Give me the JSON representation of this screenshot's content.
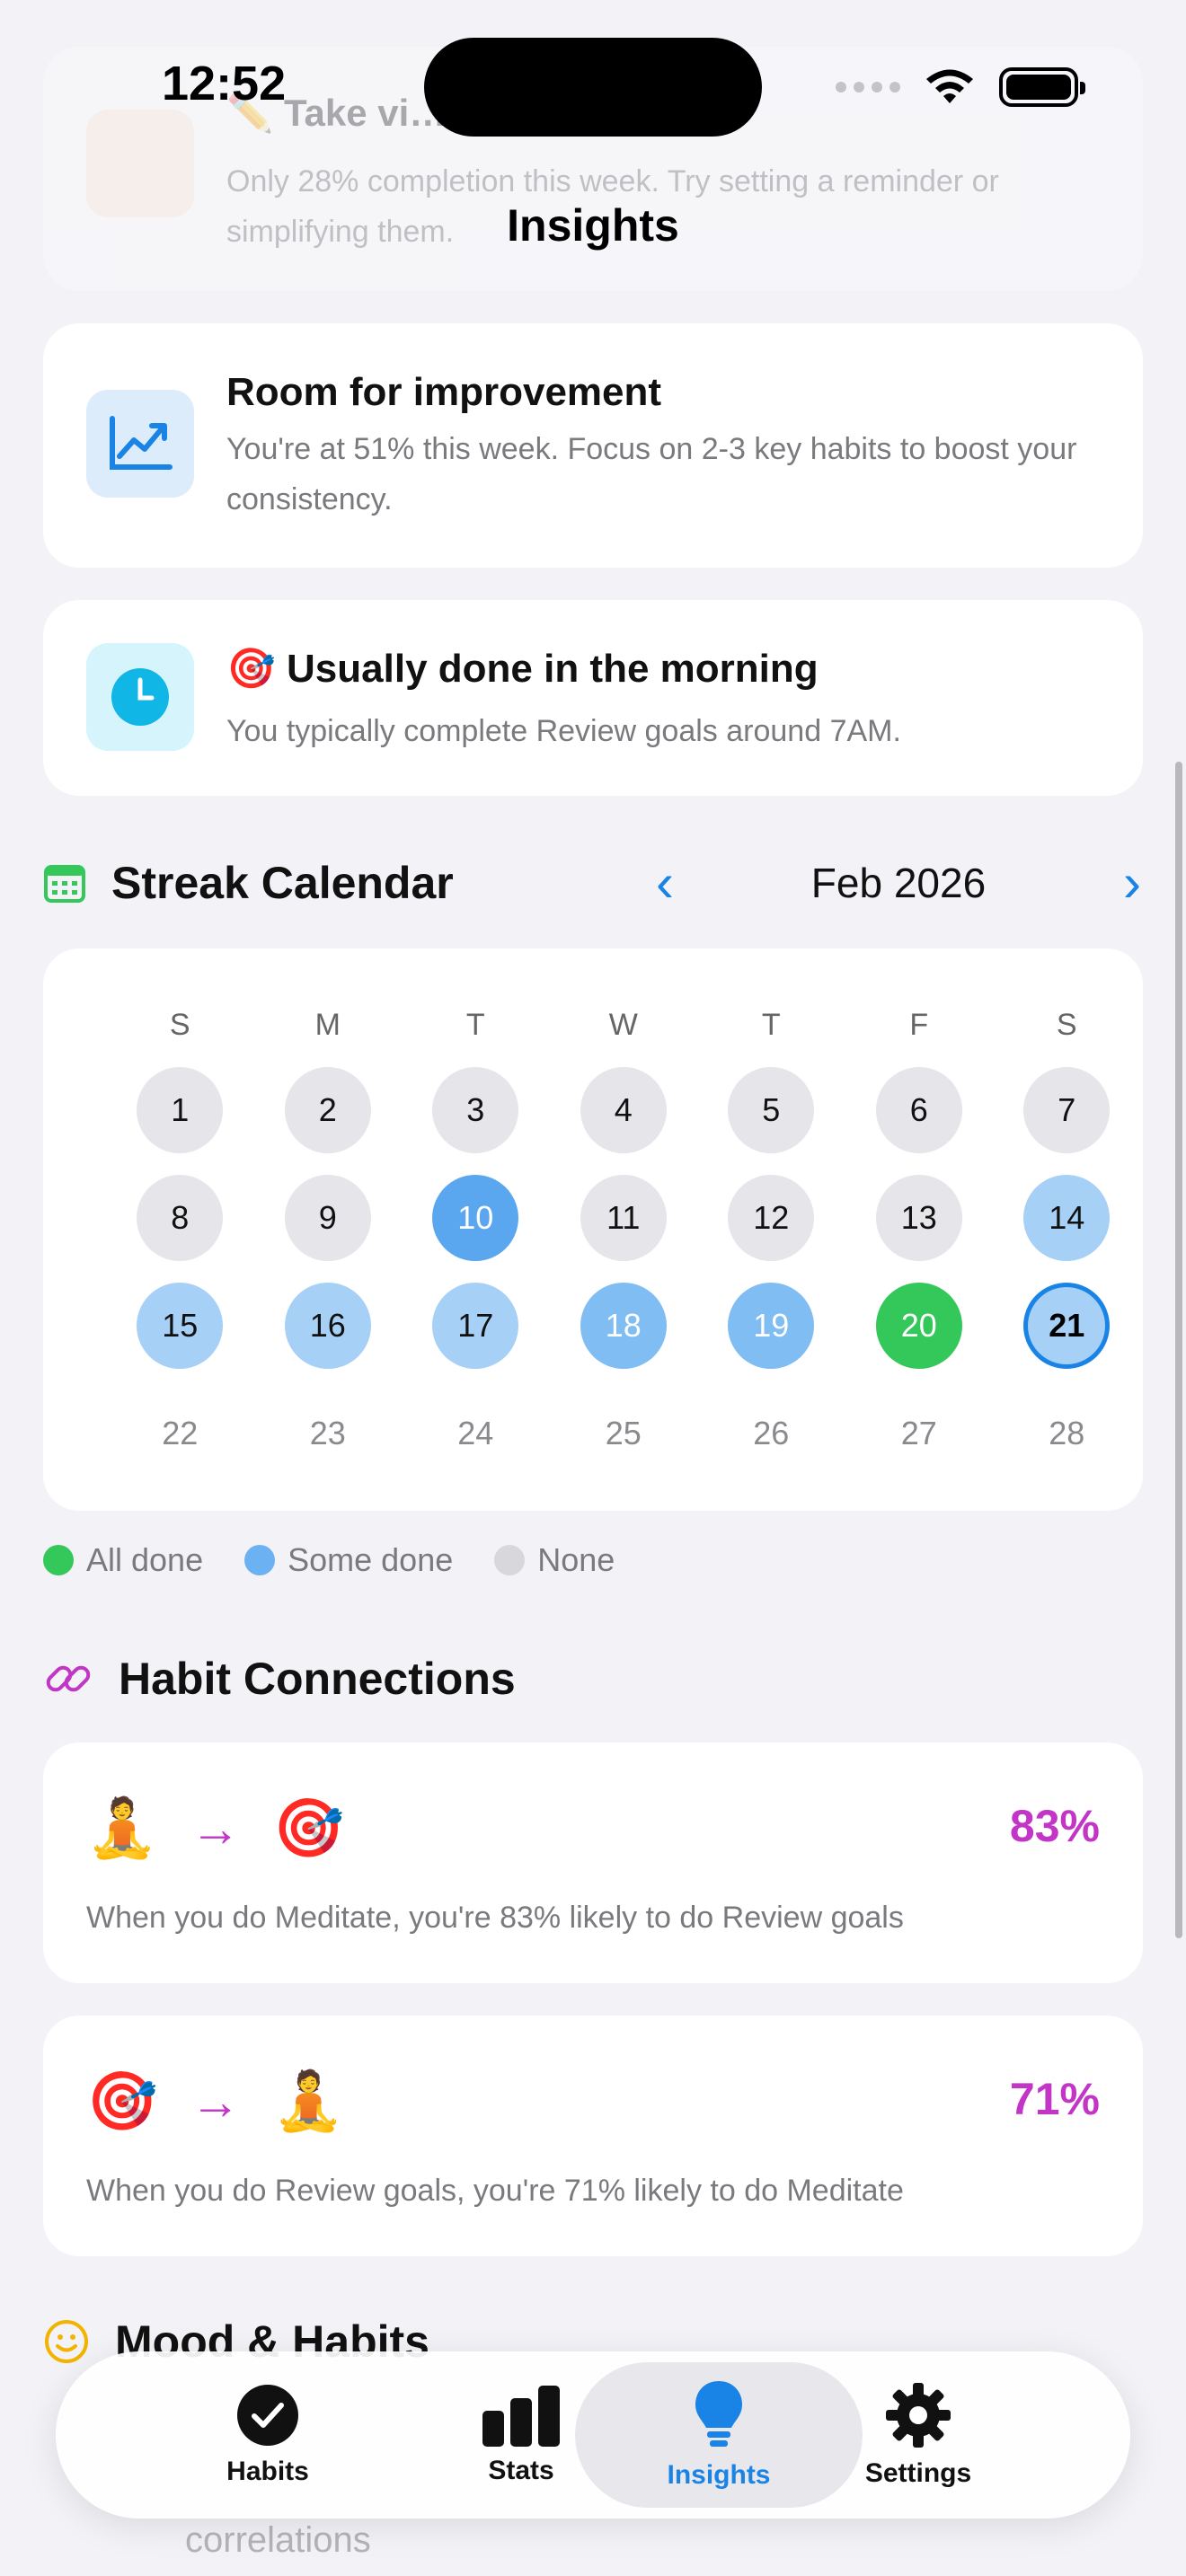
{
  "status_bar": {
    "time": "12:52"
  },
  "nav": {
    "title": "Insights"
  },
  "faded_card": {
    "title": "✏️ Take vi… attention",
    "body": "Only 28% completion this week. Try setting a reminder or simplifying them."
  },
  "insights": [
    {
      "icon": "trend-chart-icon",
      "title": "Room for improvement",
      "body": "You're at 51% this week. Focus on 2-3 key habits to boost your consistency."
    },
    {
      "icon": "clock-icon",
      "emoji": "🎯",
      "title": "Usually done in the morning",
      "body": "You typically complete Review goals around 7AM."
    }
  ],
  "streak_calendar": {
    "title": "Streak Calendar",
    "month": "Feb 2026",
    "weekdays": [
      "S",
      "M",
      "T",
      "W",
      "T",
      "F",
      "S"
    ],
    "weeks": [
      [
        {
          "d": "1",
          "s": "none"
        },
        {
          "d": "2",
          "s": "none"
        },
        {
          "d": "3",
          "s": "none"
        },
        {
          "d": "4",
          "s": "none"
        },
        {
          "d": "5",
          "s": "none"
        },
        {
          "d": "6",
          "s": "none"
        },
        {
          "d": "7",
          "s": "none"
        }
      ],
      [
        {
          "d": "8",
          "s": "none"
        },
        {
          "d": "9",
          "s": "none"
        },
        {
          "d": "10",
          "s": "some-dark"
        },
        {
          "d": "11",
          "s": "none"
        },
        {
          "d": "12",
          "s": "none"
        },
        {
          "d": "13",
          "s": "none"
        },
        {
          "d": "14",
          "s": "some"
        }
      ],
      [
        {
          "d": "15",
          "s": "some"
        },
        {
          "d": "16",
          "s": "some"
        },
        {
          "d": "17",
          "s": "some"
        },
        {
          "d": "18",
          "s": "some-mid"
        },
        {
          "d": "19",
          "s": "some-mid"
        },
        {
          "d": "20",
          "s": "all"
        },
        {
          "d": "21",
          "s": "today"
        }
      ],
      [
        {
          "d": "22",
          "s": "future"
        },
        {
          "d": "23",
          "s": "future"
        },
        {
          "d": "24",
          "s": "future"
        },
        {
          "d": "25",
          "s": "future"
        },
        {
          "d": "26",
          "s": "future"
        },
        {
          "d": "27",
          "s": "future"
        },
        {
          "d": "28",
          "s": "future"
        }
      ]
    ],
    "legend": [
      {
        "label": "All done",
        "color": "#34c759"
      },
      {
        "label": "Some done",
        "color": "#6cb1f2"
      },
      {
        "label": "None",
        "color": "#d8d8dc"
      }
    ]
  },
  "habit_connections": {
    "title": "Habit Connections",
    "items": [
      {
        "from": "🧘",
        "to": "🎯",
        "percent": "83%",
        "description": "When you do Meditate, you're 83% likely to do Review goals"
      },
      {
        "from": "🎯",
        "to": "🧘",
        "percent": "71%",
        "description": "When you do Review goals, you're 71% likely to do Meditate"
      }
    ]
  },
  "mood": {
    "title": "Mood & Habits",
    "footer_text": "correlations"
  },
  "tabbar": {
    "tabs": [
      {
        "label": "Habits",
        "icon": "checkmark-circle-icon"
      },
      {
        "label": "Stats",
        "icon": "bar-chart-icon"
      },
      {
        "label": "Insights",
        "icon": "lightbulb-icon",
        "active": true
      },
      {
        "label": "Settings",
        "icon": "gear-icon"
      }
    ]
  },
  "colors": {
    "accent": "#1a84e6",
    "connection": "#c235c7",
    "all_done": "#34c759"
  }
}
